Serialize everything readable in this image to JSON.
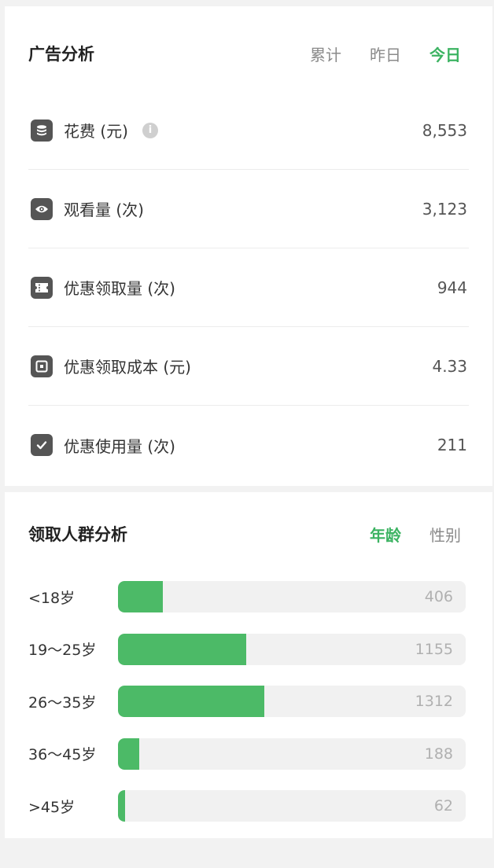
{
  "ad_analysis": {
    "title": "广告分析",
    "tabs": [
      {
        "label": "累计",
        "active": false
      },
      {
        "label": "昨日",
        "active": false
      },
      {
        "label": "今日",
        "active": true
      }
    ],
    "metrics": [
      {
        "icon": "database-icon",
        "label": "花费 (元)",
        "value": "8,553",
        "has_info": true
      },
      {
        "icon": "eye-icon",
        "label": "观看量 (次)",
        "value": "3,123"
      },
      {
        "icon": "ticket-icon",
        "label": "优惠领取量 (次)",
        "value": "944"
      },
      {
        "icon": "plus-square-icon",
        "label": "优惠领取成本 (元)",
        "value": "4.33"
      },
      {
        "icon": "check-square-icon",
        "label": "优惠使用量 (次)",
        "value": "211"
      }
    ],
    "info_icon_glyph": "i"
  },
  "crowd_analysis": {
    "title": "领取人群分析",
    "tabs": [
      {
        "label": "年龄",
        "active": true
      },
      {
        "label": "性别",
        "active": false
      }
    ],
    "max_value": 1312,
    "max_fill_fraction": 0.42,
    "bars": [
      {
        "label": "<18岁",
        "value": 406
      },
      {
        "label": "19～25岁",
        "value": 1155
      },
      {
        "label": "26～35岁",
        "value": 1312
      },
      {
        "label": "36～45岁",
        "value": 188
      },
      {
        "label": ">45岁",
        "value": 62
      }
    ]
  },
  "colors": {
    "accent": "#3cb362",
    "bar_fill": "#4cba67",
    "bar_track": "#f1f1f1",
    "icon_bg": "#555555"
  }
}
